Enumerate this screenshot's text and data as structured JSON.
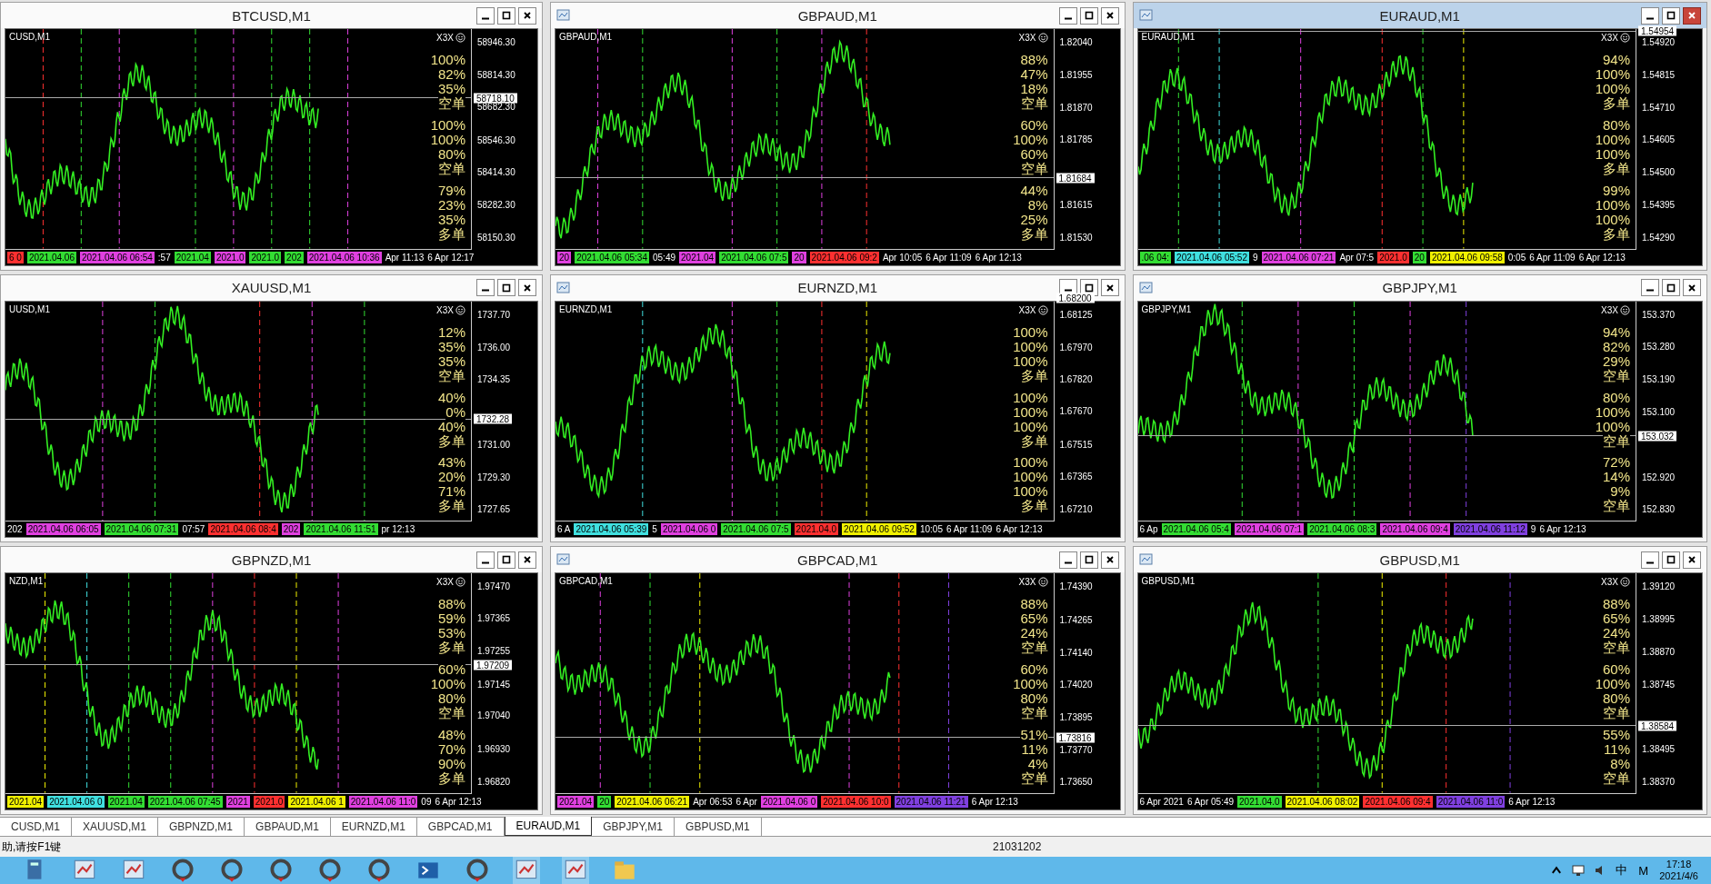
{
  "charts": [
    {
      "title": "BTCUSD,M1",
      "active": false,
      "label": "CUSD,M1",
      "badge": "X3X",
      "price": "58718.10",
      "ticks": [
        "58946.30",
        "58814.30",
        "58682.30",
        "58546.30",
        "58414.30",
        "58282.30",
        "58150.30"
      ],
      "groups": [
        {
          "values": [
            "100%",
            "82%",
            "35%"
          ],
          "side": "空单"
        },
        {
          "values": [
            "100%",
            "100%",
            "80%"
          ],
          "side": "空单"
        },
        {
          "values": [
            "79%",
            "23%",
            "35%"
          ],
          "side": "多单"
        }
      ],
      "times": [
        {
          "kind": "tag",
          "text": "6 0",
          "color": "#ff3030"
        },
        {
          "kind": "tag",
          "text": "2021.04.06",
          "color": "#33dd33"
        },
        {
          "kind": "tag",
          "text": "2021.04.06 06:54",
          "color": "#e040e0"
        },
        {
          "kind": "plain",
          "text": ":57"
        },
        {
          "kind": "tag",
          "text": "2021.04",
          "color": "#33dd33"
        },
        {
          "kind": "tag",
          "text": "2021.0",
          "color": "#e040e0"
        },
        {
          "kind": "tag",
          "text": "2021.0",
          "color": "#33dd33"
        },
        {
          "kind": "tag",
          "text": "202",
          "color": "#33dd33"
        },
        {
          "kind": "tag",
          "text": "2021.04.06 10:36",
          "color": "#e040e0"
        },
        {
          "kind": "plain",
          "text": "Apr 11:13"
        },
        {
          "kind": "plain",
          "text": "6 Apr 12:17"
        }
      ]
    },
    {
      "title": "GBPAUD,M1",
      "active": false,
      "label": "GBPAUD,M1",
      "badge": "X3X",
      "price": "1.81684",
      "ticks": [
        "1.82040",
        "1.81955",
        "1.81870",
        "1.81785",
        "1.81615",
        "1.81530"
      ],
      "groups": [
        {
          "values": [
            "88%",
            "47%",
            "18%"
          ],
          "side": "空单"
        },
        {
          "values": [
            "60%",
            "100%",
            "60%"
          ],
          "side": "空单"
        },
        {
          "values": [
            "44%",
            "8%",
            "25%"
          ],
          "side": "多单"
        }
      ],
      "times": [
        {
          "kind": "tag",
          "text": "20",
          "color": "#e040e0"
        },
        {
          "kind": "tag",
          "text": "2021.04.06 05:34",
          "color": "#33dd33"
        },
        {
          "kind": "plain",
          "text": "05:49"
        },
        {
          "kind": "tag",
          "text": "2021.04",
          "color": "#e040e0"
        },
        {
          "kind": "tag",
          "text": "2021.04.06 07:5",
          "color": "#33dd33"
        },
        {
          "kind": "tag",
          "text": "20",
          "color": "#e040e0"
        },
        {
          "kind": "tag",
          "text": "2021.04.06 09:2",
          "color": "#ff3030"
        },
        {
          "kind": "plain",
          "text": "Apr 10:05"
        },
        {
          "kind": "plain",
          "text": "6 Apr 11:09"
        },
        {
          "kind": "plain",
          "text": "6 Apr 12:13"
        }
      ]
    },
    {
      "title": "EURAUD,M1",
      "active": true,
      "label": "EURAUD,M1",
      "badge": "X3X",
      "price": "1.54954",
      "ticks": [
        "1.54920",
        "1.54815",
        "1.54710",
        "1.54605",
        "1.54500",
        "1.54395",
        "1.54290"
      ],
      "groups": [
        {
          "values": [
            "94%",
            "100%",
            "100%"
          ],
          "side": "多单"
        },
        {
          "values": [
            "80%",
            "100%",
            "100%"
          ],
          "side": "多单"
        },
        {
          "values": [
            "99%",
            "100%",
            "100%"
          ],
          "side": "多单"
        }
      ],
      "times": [
        {
          "kind": "tag",
          "text": ".06 04:",
          "color": "#33dd33"
        },
        {
          "kind": "tag",
          "text": "2021.04.06 05:52",
          "color": "#40e0e0"
        },
        {
          "kind": "plain",
          "text": "9"
        },
        {
          "kind": "tag",
          "text": "2021.04.06 07:21",
          "color": "#e040e0"
        },
        {
          "kind": "plain",
          "text": "Apr 07:5"
        },
        {
          "kind": "tag",
          "text": "2021.0",
          "color": "#ff3030"
        },
        {
          "kind": "tag",
          "text": "20",
          "color": "#33dd33"
        },
        {
          "kind": "tag",
          "text": "2021.04.06 09:58",
          "color": "#f0f000"
        },
        {
          "kind": "plain",
          "text": "0:05"
        },
        {
          "kind": "plain",
          "text": "6 Apr 11:09"
        },
        {
          "kind": "plain",
          "text": "6 Apr 12:13"
        }
      ]
    },
    {
      "title": "XAUUSD,M1",
      "active": false,
      "label": "UUSD,M1",
      "badge": "X3X",
      "price": "1732.28",
      "ticks": [
        "1737.70",
        "1736.00",
        "1734.35",
        "1731.00",
        "1729.30",
        "1727.65"
      ],
      "groups": [
        {
          "values": [
            "12%",
            "35%",
            "35%"
          ],
          "side": "空单"
        },
        {
          "values": [
            "40%",
            "0%",
            "40%"
          ],
          "side": "多单"
        },
        {
          "values": [
            "43%",
            "20%",
            "71%"
          ],
          "side": "多单"
        }
      ],
      "times": [
        {
          "kind": "plain",
          "text": "202"
        },
        {
          "kind": "tag",
          "text": "2021.04.06 06:05",
          "color": "#e040e0"
        },
        {
          "kind": "tag",
          "text": "2021.04.06 07:31",
          "color": "#33dd33"
        },
        {
          "kind": "plain",
          "text": "07:57"
        },
        {
          "kind": "tag",
          "text": "2021.04.06 08:4",
          "color": "#ff3030"
        },
        {
          "kind": "tag",
          "text": "202",
          "color": "#e040e0"
        },
        {
          "kind": "tag",
          "text": "2021.04.06 11:51",
          "color": "#33dd33"
        },
        {
          "kind": "plain",
          "text": "pr 12:13"
        }
      ]
    },
    {
      "title": "EURNZD,M1",
      "active": false,
      "label": "EURNZD,M1",
      "badge": "X3X",
      "price": "1.68200",
      "ticks": [
        "1.68125",
        "1.67970",
        "1.67820",
        "1.67670",
        "1.67515",
        "1.67365",
        "1.67210"
      ],
      "groups": [
        {
          "values": [
            "100%",
            "100%",
            "100%"
          ],
          "side": "多单"
        },
        {
          "values": [
            "100%",
            "100%",
            "100%"
          ],
          "side": "多单"
        },
        {
          "values": [
            "100%",
            "100%",
            "100%"
          ],
          "side": "多单"
        }
      ],
      "times": [
        {
          "kind": "plain",
          "text": "6 A"
        },
        {
          "kind": "tag",
          "text": "2021.04.06 05:39",
          "color": "#40e0e0"
        },
        {
          "kind": "plain",
          "text": "5"
        },
        {
          "kind": "tag",
          "text": "2021.04.06 0",
          "color": "#e040e0"
        },
        {
          "kind": "tag",
          "text": "2021.04.06 07:5",
          "color": "#33dd33"
        },
        {
          "kind": "tag",
          "text": "2021.04.0",
          "color": "#ff3030"
        },
        {
          "kind": "tag",
          "text": "2021.04.06 09:52",
          "color": "#f0f000"
        },
        {
          "kind": "plain",
          "text": "10:05"
        },
        {
          "kind": "plain",
          "text": "6 Apr 11:09"
        },
        {
          "kind": "plain",
          "text": "6 Apr 12:13"
        }
      ]
    },
    {
      "title": "GBPJPY,M1",
      "active": false,
      "label": "GBPJPY,M1",
      "badge": "X3X",
      "price": "153.032",
      "ticks": [
        "153.370",
        "153.280",
        "153.190",
        "153.100",
        "152.920",
        "152.830"
      ],
      "groups": [
        {
          "values": [
            "94%",
            "82%",
            "29%"
          ],
          "side": "空单"
        },
        {
          "values": [
            "80%",
            "100%",
            "100%"
          ],
          "side": "空单"
        },
        {
          "values": [
            "72%",
            "14%",
            "9%"
          ],
          "side": "空单"
        }
      ],
      "times": [
        {
          "kind": "plain",
          "text": "6 Ap"
        },
        {
          "kind": "tag",
          "text": "2021.04.06 05:4",
          "color": "#33dd33"
        },
        {
          "kind": "tag",
          "text": "2021.04.06 07:1",
          "color": "#e040e0"
        },
        {
          "kind": "tag",
          "text": "2021.04.06 08:3",
          "color": "#33dd33"
        },
        {
          "kind": "tag",
          "text": "2021.04.06 09:4",
          "color": "#e040e0"
        },
        {
          "kind": "tag",
          "text": "2021.04.06 11:12",
          "color": "#8040e0"
        },
        {
          "kind": "plain",
          "text": "9"
        },
        {
          "kind": "plain",
          "text": "6 Apr 12:13"
        }
      ]
    },
    {
      "title": "GBPNZD,M1",
      "active": false,
      "label": "NZD,M1",
      "badge": "X3X",
      "price": "1.97209",
      "ticks": [
        "1.97470",
        "1.97365",
        "1.97255",
        "1.97145",
        "1.97040",
        "1.96930",
        "1.96820"
      ],
      "groups": [
        {
          "values": [
            "88%",
            "59%",
            "53%"
          ],
          "side": "多单"
        },
        {
          "values": [
            "60%",
            "100%",
            "80%"
          ],
          "side": "空单"
        },
        {
          "values": [
            "48%",
            "70%",
            "90%"
          ],
          "side": "多单"
        }
      ],
      "times": [
        {
          "kind": "tag",
          "text": "2021.04",
          "color": "#f0f000"
        },
        {
          "kind": "tag",
          "text": "2021.04.06 0",
          "color": "#40e0e0"
        },
        {
          "kind": "tag",
          "text": "2021.04",
          "color": "#33dd33"
        },
        {
          "kind": "tag",
          "text": "2021.04.06 07:45",
          "color": "#33dd33"
        },
        {
          "kind": "tag",
          "text": "2021",
          "color": "#e040e0"
        },
        {
          "kind": "tag",
          "text": "2021.0",
          "color": "#ff3030"
        },
        {
          "kind": "tag",
          "text": "2021.04.06 1",
          "color": "#f0f000"
        },
        {
          "kind": "tag",
          "text": "2021.04.06 11:0",
          "color": "#e040e0"
        },
        {
          "kind": "plain",
          "text": "09"
        },
        {
          "kind": "plain",
          "text": "6 Apr 12:13"
        }
      ]
    },
    {
      "title": "GBPCAD,M1",
      "active": false,
      "label": "GBPCAD,M1",
      "badge": "X3X",
      "price": "1.73816",
      "ticks": [
        "1.74390",
        "1.74265",
        "1.74140",
        "1.74020",
        "1.73895",
        "1.73770",
        "1.73650"
      ],
      "groups": [
        {
          "values": [
            "88%",
            "65%",
            "24%"
          ],
          "side": "空单"
        },
        {
          "values": [
            "60%",
            "100%",
            "80%"
          ],
          "side": "空单"
        },
        {
          "values": [
            "51%",
            "11%",
            "4%"
          ],
          "side": "空单"
        }
      ],
      "times": [
        {
          "kind": "tag",
          "text": "2021.04",
          "color": "#e040e0"
        },
        {
          "kind": "tag",
          "text": "20",
          "color": "#33dd33"
        },
        {
          "kind": "tag",
          "text": "2021.04.06 06:21",
          "color": "#f0f000"
        },
        {
          "kind": "plain",
          "text": "Apr 06:53"
        },
        {
          "kind": "plain",
          "text": "6 Apr"
        },
        {
          "kind": "tag",
          "text": "2021.04.06 0",
          "color": "#e040e0"
        },
        {
          "kind": "tag",
          "text": "2021.04.06 10:0",
          "color": "#ff3030"
        },
        {
          "kind": "tag",
          "text": "2021.04.06 11:21",
          "color": "#8040e0"
        },
        {
          "kind": "plain",
          "text": "6 Apr 12:13"
        }
      ]
    },
    {
      "title": "GBPUSD,M1",
      "active": false,
      "label": "GBPUSD,M1",
      "badge": "X3X",
      "price": "1.38584",
      "ticks": [
        "1.39120",
        "1.38995",
        "1.38870",
        "1.38745",
        "1.38495",
        "1.38370"
      ],
      "groups": [
        {
          "values": [
            "88%",
            "65%",
            "24%"
          ],
          "side": "空单"
        },
        {
          "values": [
            "60%",
            "100%",
            "80%"
          ],
          "side": "空单"
        },
        {
          "values": [
            "55%",
            "11%",
            "8%"
          ],
          "side": "空单"
        }
      ],
      "times": [
        {
          "kind": "plain",
          "text": "6 Apr 2021"
        },
        {
          "kind": "plain",
          "text": "6 Apr 05:49"
        },
        {
          "kind": "tag",
          "text": "2021.04.0",
          "color": "#33dd33"
        },
        {
          "kind": "tag",
          "text": "2021.04.06 08:02",
          "color": "#f0f000"
        },
        {
          "kind": "tag",
          "text": "2021.04.06 09:4",
          "color": "#ff3030"
        },
        {
          "kind": "tag",
          "text": "2021.04.06 11:0",
          "color": "#8040e0"
        },
        {
          "kind": "plain",
          "text": "6 Apr 12:13"
        }
      ]
    }
  ],
  "tabs": [
    {
      "label": "CUSD,M1",
      "selected": false
    },
    {
      "label": "XAUUSD,M1",
      "selected": false
    },
    {
      "label": "GBPNZD,M1",
      "selected": false
    },
    {
      "label": "GBPAUD,M1",
      "selected": false
    },
    {
      "label": "EURNZD,M1",
      "selected": false
    },
    {
      "label": "GBPCAD,M1",
      "selected": false
    },
    {
      "label": "EURAUD,M1",
      "selected": true
    },
    {
      "label": "GBPJPY,M1",
      "selected": false
    },
    {
      "label": "GBPUSD,M1",
      "selected": false
    }
  ],
  "status_bar": {
    "help": "助,请按F1键",
    "code": "21031202"
  },
  "taskbar": {
    "tray": [
      "中",
      "M"
    ],
    "time": "17:18",
    "date": "2021/4/6"
  }
}
